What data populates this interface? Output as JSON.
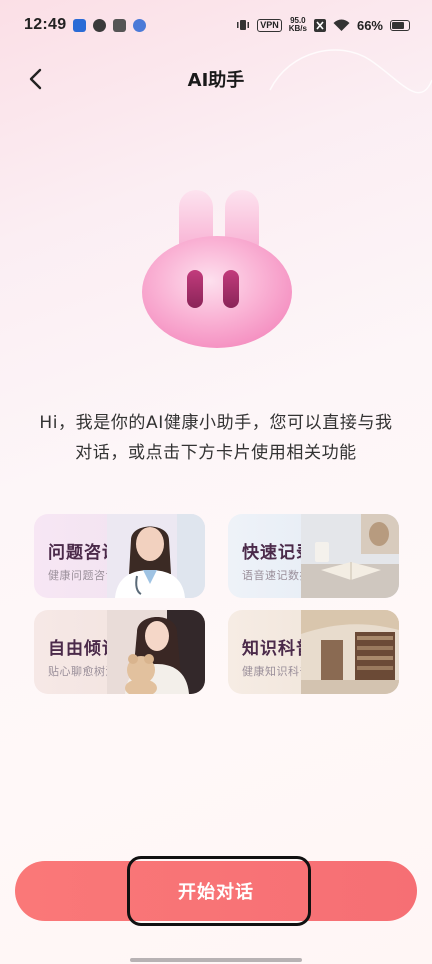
{
  "status_bar": {
    "time": "12:49",
    "vpn": "VPN",
    "speed_value": "95.0",
    "speed_unit": "KB/s",
    "battery": "66%"
  },
  "header": {
    "title": "AI助手",
    "back_icon": "chevron-left-icon"
  },
  "intro": {
    "text": "Hi，我是你的AI健康小助手，您可以直接与我对话，或点击下方卡片使用相关功能"
  },
  "cards": [
    {
      "title": "问题咨询",
      "subtitle": "健康问题咨询"
    },
    {
      "title": "快速记录",
      "subtitle": "语音速记数据"
    },
    {
      "title": "自由倾诉",
      "subtitle": "贴心聊愈树洞"
    },
    {
      "title": "知识科普",
      "subtitle": "健康知识科普"
    }
  ],
  "start_button": {
    "label": "开始对话"
  },
  "colors": {
    "accent": "#f77474",
    "title_text": "#4b2a4a",
    "mascot_pink": "#f8a6cf",
    "mascot_eyes": "#a0306a"
  }
}
